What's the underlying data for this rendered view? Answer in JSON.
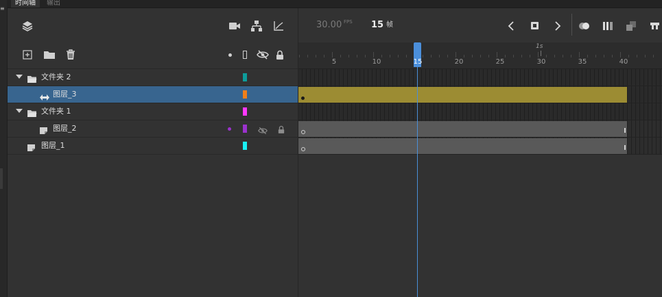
{
  "tabs": [
    {
      "label": "时间轴",
      "active": true
    },
    {
      "label": "输出",
      "active": false
    }
  ],
  "playback": {
    "fps_value": "30.00",
    "fps_label": "FPS",
    "current_frame": "15",
    "frame_unit": "帧"
  },
  "ruler": {
    "second_marker": "1s",
    "ticks": [
      "5",
      "10",
      "15",
      "20",
      "25",
      "30",
      "35",
      "40"
    ]
  },
  "layers": [
    {
      "label": "文件夹 2",
      "type": "folder",
      "expanded": true,
      "indent": 0,
      "color": "#0e9c9a",
      "selected": false
    },
    {
      "label": "图层_3",
      "type": "motion",
      "indent": 1,
      "color": "#f07f19",
      "selected": true
    },
    {
      "label": "文件夹 1",
      "type": "folder",
      "expanded": true,
      "indent": 0,
      "color": "#ff38ff",
      "selected": false
    },
    {
      "label": "图层_2",
      "type": "layer",
      "indent": 1,
      "color": "#9b32cd",
      "selected": false,
      "hidden": true,
      "locked": true
    },
    {
      "label": "图层_1",
      "type": "layer",
      "indent": 0,
      "color": "#19f0f5",
      "selected": false
    }
  ],
  "frames": {
    "total_frames_shown": 40,
    "current_frame": 15,
    "tween_color": "#9c8c33",
    "static_color": "#595959"
  },
  "colors": {
    "selection": "#38658f",
    "playhead": "#4b8fdb"
  }
}
